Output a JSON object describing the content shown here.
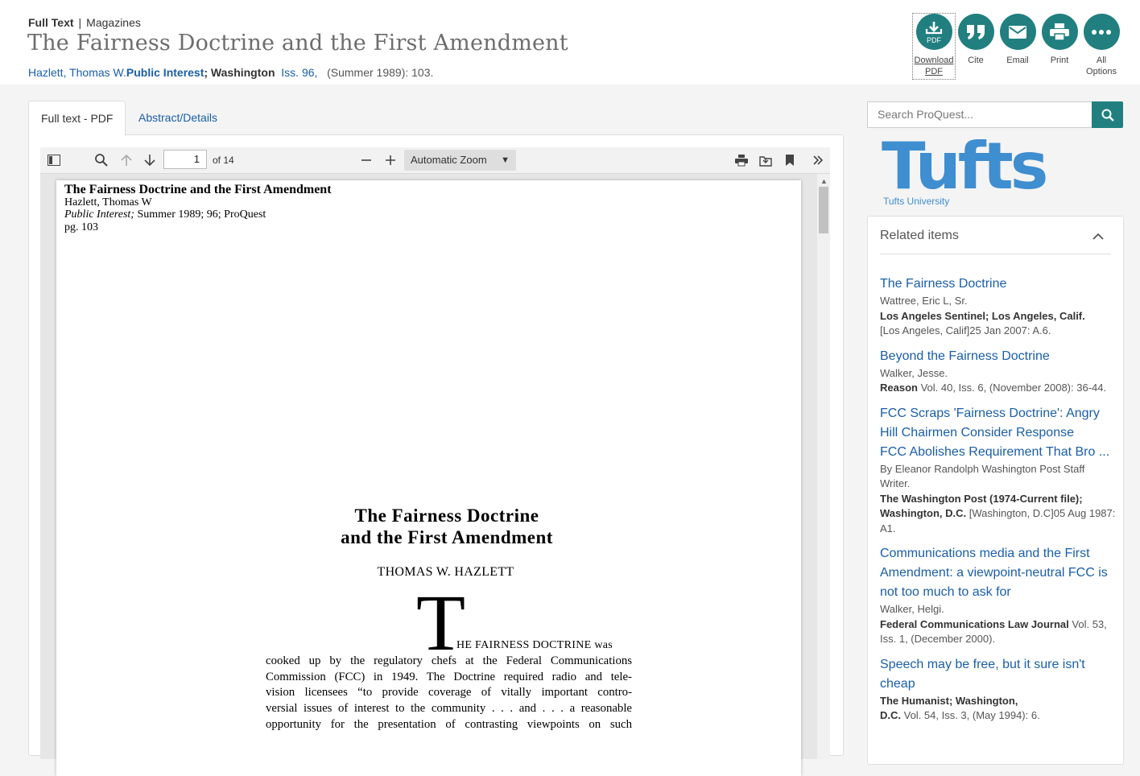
{
  "breadcrumb": {
    "type": "Full Text",
    "separator": "|",
    "category": "Magazines"
  },
  "document": {
    "title": "The Fairness Doctrine and the First Amendment",
    "author": "Hazlett, Thomas W.",
    "publication": "Public Interest",
    "place": "; Washington",
    "issue": "Iss. 96,",
    "date_pages": "(Summer 1989): 103."
  },
  "actions": [
    {
      "name": "download-pdf",
      "label_line1": "Download",
      "label_line2": "PDF",
      "icon_text": "PDF",
      "icon": "download-pdf-icon"
    },
    {
      "name": "cite",
      "label": "Cite",
      "icon": "quote-icon"
    },
    {
      "name": "email",
      "label": "Email",
      "icon": "envelope-icon"
    },
    {
      "name": "print",
      "label": "Print",
      "icon": "printer-icon"
    },
    {
      "name": "all-options",
      "label_line1": "All",
      "label_line2": "Options",
      "icon": "more-icon"
    }
  ],
  "tabs": [
    {
      "label": "Full text - PDF",
      "active": true
    },
    {
      "label": "Abstract/Details",
      "active": false
    }
  ],
  "viewer": {
    "page_number": "1",
    "page_count": "of 14",
    "zoom": "Automatic Zoom"
  },
  "pdf": {
    "header_title": "The Fairness Doctrine and the First Amendment",
    "header_author": "Hazlett, Thomas W",
    "header_source_italic": "Public Interest;",
    "header_source_rest": " Summer 1989; 96; ProQuest",
    "header_pages": "pg. 103",
    "article_title_line1": "The Fairness Doctrine",
    "article_title_line2": "and the First Amendment",
    "article_author": "THOMAS W. HAZLETT",
    "drop_cap": "T",
    "first_line": "HE FAIRNESS DOCTRINE was",
    "body_lines": [
      "cooked up by the regulatory chefs at the Federal Communications",
      "Commission (FCC) in 1949. The Doctrine required radio and tele-",
      "vision licensees “to provide coverage of vitally important contro-",
      "versial issues of interest to the community . . . and . . . a reasonable",
      "opportunity for the presentation of contrasting viewpoints on such"
    ]
  },
  "search": {
    "placeholder": "Search ProQuest..."
  },
  "institution": {
    "logo_text": "Tufts",
    "name": "Tufts University"
  },
  "related": {
    "heading": "Related items",
    "items": [
      {
        "title": "The Fairness Doctrine",
        "author": "Wattree, Eric L, Sr.",
        "source": "Los Angeles Sentinel; Los Angeles, Calif.",
        "details": "[Los Angeles, Calif]25 Jan 2007: A.6."
      },
      {
        "title": "Beyond the Fairness Doctrine",
        "author": "Walker, Jesse.",
        "source": "Reason",
        "details": " Vol. 40, Iss. 6,  (November 2008): 36-44."
      },
      {
        "title": "FCC Scraps 'Fairness Doctrine': Angry Hill Chairmen Consider Response",
        "title2": "FCC Abolishes Requirement That Bro ...",
        "author": "By Eleanor Randolph Washington Post Staff Writer.",
        "source": "The Washington Post (1974-Current file); Washington, D.C.",
        "details": " [Washington, D.C]05 Aug 1987: A1."
      },
      {
        "title": "Communications media and the First Amendment: a viewpoint-neutral FCC is not too much to ask for",
        "author": "Walker, Helgi.",
        "source": "Federal Communications Law Journal",
        "details": " Vol. 53, Iss. 1,  (December 2000)."
      },
      {
        "title": "Speech may be free, but it sure isn't cheap",
        "source": "The Humanist; Washington, D.C.",
        "details": " Vol. 54, Iss. 3,  (May 1994): 6."
      }
    ]
  }
}
